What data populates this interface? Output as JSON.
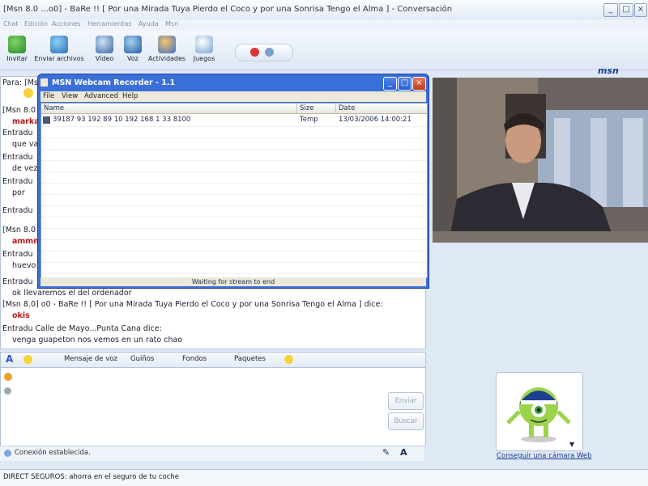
{
  "window": {
    "title": "[Msn 8.0 ...o0] - BaRe !! [ Por una Mirada Tuya Pierdo el Coco y por una Sonrisa Tengo el Alma ] - Conversación",
    "menu": [
      "Chat",
      "Edición",
      "Acciones",
      "Herramientas",
      "Ayuda",
      "Msn"
    ]
  },
  "toolbar": {
    "items": [
      {
        "label": "Invitar",
        "icon": "invite-icon"
      },
      {
        "label": "Enviar archivos",
        "icon": "send-files-icon"
      },
      {
        "label": "Vídeo",
        "icon": "video-icon"
      },
      {
        "label": "Voz",
        "icon": "voice-icon"
      },
      {
        "label": "Actividades",
        "icon": "activities-icon"
      },
      {
        "label": "Juegos",
        "icon": "games-icon"
      }
    ],
    "brand": "msn"
  },
  "conversation": {
    "header_fragment": "Para: [Ms",
    "lines": [
      {
        "text": "[Msn 8.0",
        "style": "normal"
      },
      {
        "text": "marka",
        "style": "red"
      },
      {
        "text": "Entradu",
        "style": "normal"
      },
      {
        "text": "que va",
        "style": "normal"
      },
      {
        "text": "Entradu",
        "style": "normal"
      },
      {
        "text": "de vez",
        "style": "normal"
      },
      {
        "text": "Entradu",
        "style": "normal"
      },
      {
        "text": "por",
        "style": "normal"
      },
      {
        "text": "Entradu",
        "style": "normal"
      },
      {
        "text": "[Msn 8.0",
        "style": "normal"
      },
      {
        "text": "ammm",
        "style": "red"
      },
      {
        "text": "Entradu",
        "style": "normal"
      },
      {
        "text": "huevo",
        "style": "normal"
      },
      {
        "text": "Entradu",
        "style": "normal"
      },
      {
        "text": "ok llevaremos el del ordenador",
        "style": "normal"
      },
      {
        "text": "[Msn 8.0] o0 - BaRe !! [ Por una Mirada Tuya Pierdo el Coco y por una Sonrisa Tengo el Alma ] dice:",
        "style": "normal"
      },
      {
        "text": "okis",
        "style": "red"
      },
      {
        "text": "Entradu  Calle de Mayo...Punta Cana  dice:",
        "style": "normal"
      },
      {
        "text": "venga guapeton nos vemos en un rato chao",
        "style": "normal"
      }
    ]
  },
  "format_bar": {
    "items": [
      "Mensaje de voz",
      "Guiños",
      "Fondos",
      "Paquetes"
    ]
  },
  "input": {
    "send_label": "Enviar",
    "search_label": "Buscar"
  },
  "status": {
    "text": "Conexión establecida."
  },
  "webcam": {
    "link": "Conseguir una cámara Web"
  },
  "ad": {
    "text": "DIRECT SEGUROS: ahorra en el seguro de tu coche"
  },
  "recorder": {
    "title": "MSN Webcam Recorder - 1.1",
    "menu": [
      "File",
      "View",
      "Advanced",
      "Help"
    ],
    "columns": [
      "Name",
      "Size",
      "Date"
    ],
    "rows": [
      {
        "name": "39187  93 192 89 10 192 168 1 33 8100",
        "size": "Temp",
        "date": "13/03/2006 14:00:21"
      }
    ],
    "status": "Waiting for stream to end"
  },
  "colors": {
    "xp_blue": "#3b6fd8",
    "msn_accent": "#1a3c8c",
    "red_text": "#c01818"
  }
}
